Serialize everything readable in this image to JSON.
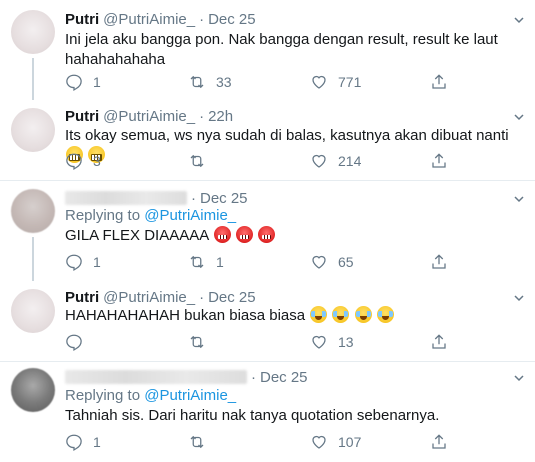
{
  "tweets": [
    {
      "name": "Putri",
      "handle": "@PutriAimie_",
      "time": "Dec 25",
      "text": "Ini jela aku bangga pon. Nak bangga dengan result, result ke laut hahahahahaha",
      "replies": "1",
      "retweets": "33",
      "likes": "771"
    },
    {
      "name": "Putri",
      "handle": "@PutriAimie_",
      "time": "22h",
      "text": "Its okay semua, ws nya sudah di balas, kasutnya akan dibuat nanti",
      "emoji": [
        "grimacing-face-emoji",
        "grimacing-face-emoji"
      ],
      "replies": "3",
      "retweets": "",
      "likes": "214"
    },
    {
      "name": "",
      "handle": "",
      "time": "Dec 25",
      "replying_label": "Replying to",
      "replying_to": "@PutriAimie_",
      "text": "GILA FLEX DIAAAAA",
      "emoji": [
        "angry-face-emoji",
        "angry-face-emoji",
        "angry-face-emoji"
      ],
      "replies": "1",
      "retweets": "1",
      "likes": "65"
    },
    {
      "name": "Putri",
      "handle": "@PutriAimie_",
      "time": "Dec 25",
      "text": "HAHAHAHAHAH bukan biasa biasa",
      "emoji": [
        "crying-laughing-emoji",
        "crying-laughing-emoji",
        "crying-laughing-emoji",
        "crying-laughing-emoji"
      ],
      "replies": "",
      "retweets": "",
      "likes": "13"
    },
    {
      "name": "",
      "handle": "",
      "time": "Dec 25",
      "replying_label": "Replying to",
      "replying_to": "@PutriAimie_",
      "text": "Tahniah sis. Dari haritu nak tanya quotation sebenarnya.",
      "replies": "1",
      "retweets": "",
      "likes": "107"
    }
  ],
  "icons": {
    "reply": "reply-icon",
    "retweet": "retweet-icon",
    "like": "heart-icon",
    "share": "share-icon",
    "more": "chevron-down-icon"
  },
  "colors": {
    "text": "#14171a",
    "muted": "#657786",
    "link": "#1b95e0",
    "separator": "#e6ecf0"
  }
}
